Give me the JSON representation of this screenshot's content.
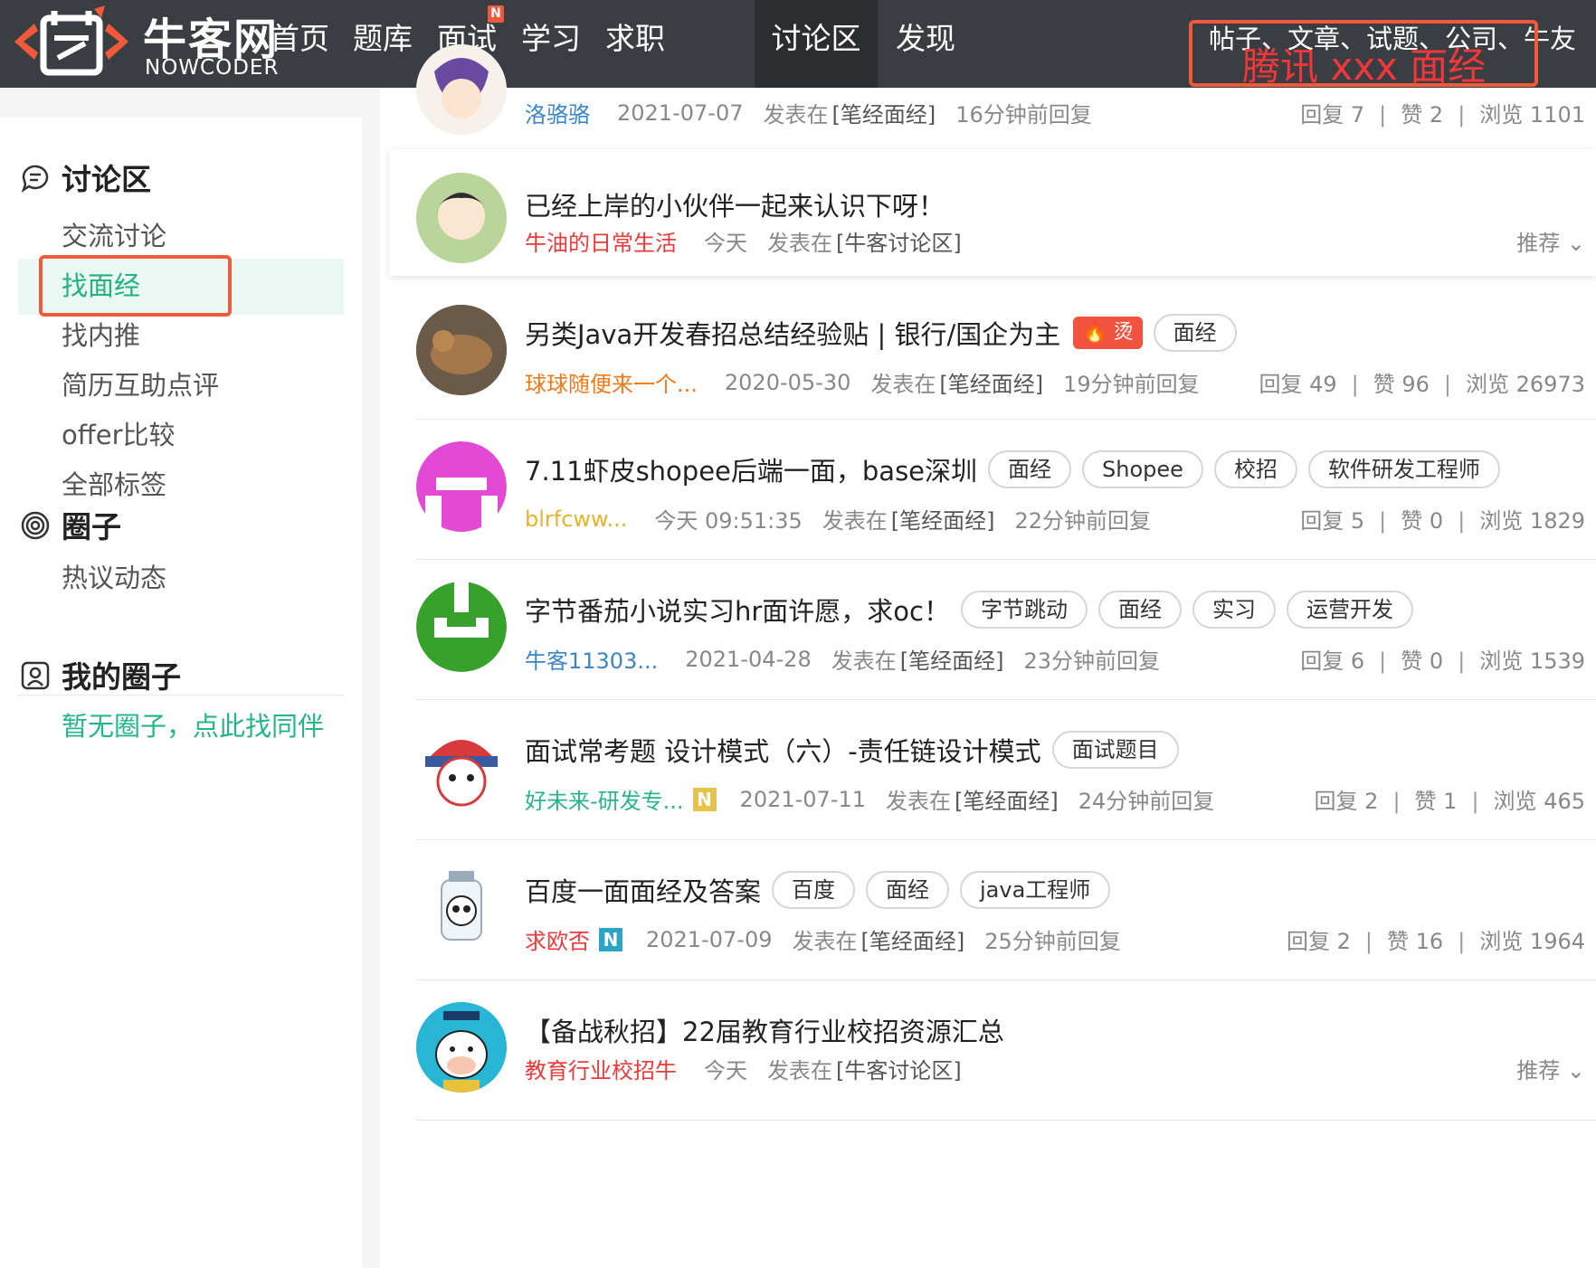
{
  "nav": {
    "logo_cn": "牛客网",
    "logo_en": "NOWCODER",
    "items": [
      {
        "label": "首页"
      },
      {
        "label": "题库"
      },
      {
        "label": "面试",
        "badge": "N"
      },
      {
        "label": "学习"
      },
      {
        "label": "求职"
      },
      {
        "label": "讨论区",
        "active": true
      },
      {
        "label": "发现"
      }
    ],
    "search_hint": "帖子、文章、试题、公司、牛友",
    "search_value": "腾讯 xxx 面经"
  },
  "sidebar": {
    "discussion_title": "讨论区",
    "discussion_items": [
      "交流讨论",
      "找面经",
      "找内推",
      "简历互助点评",
      "offer比较",
      "全部标签"
    ],
    "circle_title": "圈子",
    "circle_items": [
      "热议动态"
    ],
    "my_circle_title": "我的圈子",
    "my_circle_link": "暂无圈子，点此找同伴"
  },
  "posts": [
    {
      "title": "",
      "author": "洛骆骆",
      "author_color": "#3a86c8",
      "date": "2021-07-07",
      "posted_in": "发表在",
      "board": "[笔经面经]",
      "reply_time": "16分钟前回复",
      "replies_label": "回复",
      "replies": "7",
      "likes_label": "赞",
      "likes": "2",
      "views_label": "浏览",
      "views": "1101"
    },
    {
      "title": "已经上岸的小伙伴一起来认识下呀！",
      "author": "牛油的日常生活",
      "author_color": "#f0383a",
      "date": "今天",
      "posted_in": "发表在",
      "board": "[牛客讨论区]",
      "recommend": "推荐 ⌄"
    },
    {
      "title": "另类Java开发春招总结经验贴 | 银行/国企为主",
      "hot": "🔥 烫",
      "tags": [
        "面经"
      ],
      "author": "球球随便来一个...",
      "author_color": "#f07a1a",
      "date": "2020-05-30",
      "posted_in": "发表在",
      "board": "[笔经面经]",
      "reply_time": "19分钟前回复",
      "replies_label": "回复",
      "replies": "49",
      "likes_label": "赞",
      "likes": "96",
      "views_label": "浏览",
      "views": "26973"
    },
    {
      "title": "7.11虾皮shopee后端一面，base深圳",
      "tags": [
        "面经",
        "Shopee",
        "校招",
        "软件研发工程师"
      ],
      "author": "blrfcww...",
      "author_color": "#e8b32a",
      "date": "今天 09:51:35",
      "posted_in": "发表在",
      "board": "[笔经面经]",
      "reply_time": "22分钟前回复",
      "replies_label": "回复",
      "replies": "5",
      "likes_label": "赞",
      "likes": "0",
      "views_label": "浏览",
      "views": "1829"
    },
    {
      "title": "字节番茄小说实习hr面许愿，求oc！",
      "tags": [
        "字节跳动",
        "面经",
        "实习",
        "运营开发"
      ],
      "author": "牛客11303...",
      "author_color": "#3a86c8",
      "date": "2021-04-28",
      "posted_in": "发表在",
      "board": "[笔经面经]",
      "reply_time": "23分钟前回复",
      "replies_label": "回复",
      "replies": "6",
      "likes_label": "赞",
      "likes": "0",
      "views_label": "浏览",
      "views": "1539"
    },
    {
      "title": "面试常考题 设计模式（六）-责任链设计模式",
      "tags": [
        "面试题目"
      ],
      "author": "好未来-研发专...",
      "author_color": "#25b58a",
      "nbadge": "N",
      "nbadge_color": "#e6c34a",
      "date": "2021-07-11",
      "posted_in": "发表在",
      "board": "[笔经面经]",
      "reply_time": "24分钟前回复",
      "replies_label": "回复",
      "replies": "2",
      "likes_label": "赞",
      "likes": "1",
      "views_label": "浏览",
      "views": "465"
    },
    {
      "title": "百度一面面经及答案",
      "tags": [
        "百度",
        "面经",
        "java工程师"
      ],
      "author": "求欧否",
      "author_color": "#f0383a",
      "nbadge": "N",
      "nbadge_color": "#2aa5c8",
      "date": "2021-07-09",
      "posted_in": "发表在",
      "board": "[笔经面经]",
      "reply_time": "25分钟前回复",
      "replies_label": "回复",
      "replies": "2",
      "likes_label": "赞",
      "likes": "16",
      "views_label": "浏览",
      "views": "1964"
    },
    {
      "title": "【备战秋招】22届教育行业校招资源汇总",
      "author": "教育行业校招牛",
      "author_color": "#f0383a",
      "date": "今天",
      "posted_in": "发表在",
      "board": "[牛客讨论区]",
      "recommend": "推荐 ⌄"
    }
  ]
}
